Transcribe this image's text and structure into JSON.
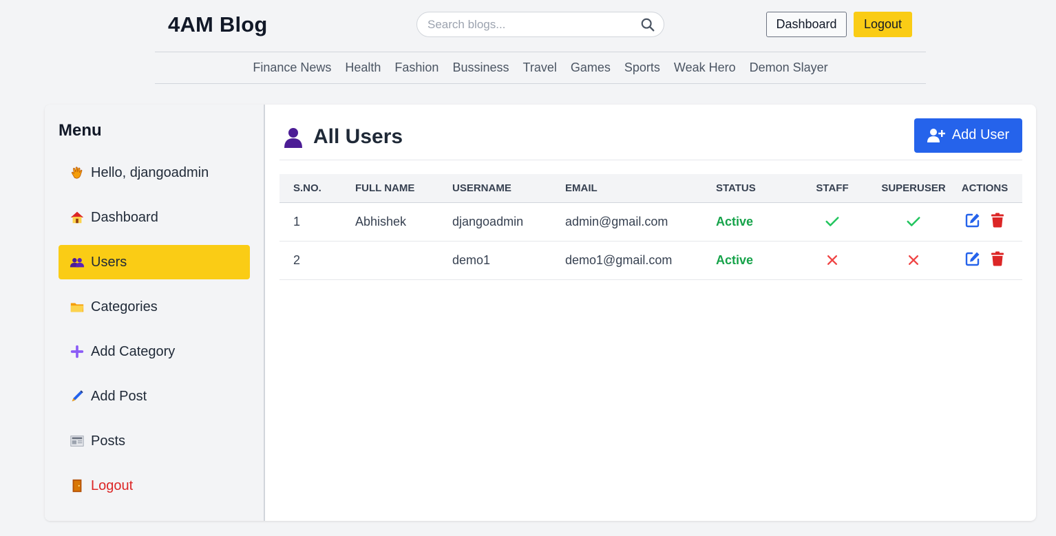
{
  "header": {
    "brand": "4AM Blog",
    "search_placeholder": "Search blogs...",
    "dashboard_label": "Dashboard",
    "logout_label": "Logout"
  },
  "nav": [
    "Finance News",
    "Health",
    "Fashion",
    "Bussiness",
    "Travel",
    "Games",
    "Sports",
    "Weak Hero",
    "Demon Slayer"
  ],
  "sidebar": {
    "title": "Menu",
    "items": [
      {
        "label": "Hello, djangoadmin",
        "icon": "waving-hand-icon"
      },
      {
        "label": "Dashboard",
        "icon": "house-icon"
      },
      {
        "label": "Users",
        "icon": "users-icon",
        "active": true
      },
      {
        "label": "Categories",
        "icon": "folder-icon"
      },
      {
        "label": "Add Category",
        "icon": "plus-icon"
      },
      {
        "label": "Add Post",
        "icon": "pen-icon"
      },
      {
        "label": "Posts",
        "icon": "newspaper-icon"
      },
      {
        "label": "Logout",
        "icon": "door-icon"
      }
    ]
  },
  "main": {
    "title": "All Users",
    "add_user_label": "Add User",
    "columns": [
      "S.No.",
      "Full Name",
      "Username",
      "Email",
      "Status",
      "Staff",
      "Superuser",
      "Actions"
    ],
    "rows": [
      {
        "sno": "1",
        "full_name": "Abhishek",
        "username": "djangoadmin",
        "email": "admin@gmail.com",
        "status": "Active",
        "staff": true,
        "superuser": true
      },
      {
        "sno": "2",
        "full_name": "",
        "username": "demo1",
        "email": "demo1@gmail.com",
        "status": "Active",
        "staff": false,
        "superuser": false
      }
    ]
  },
  "colors": {
    "accent_yellow": "#facc15",
    "primary_blue": "#2563eb",
    "success_green": "#16a34a",
    "danger_red": "#dc2626"
  }
}
